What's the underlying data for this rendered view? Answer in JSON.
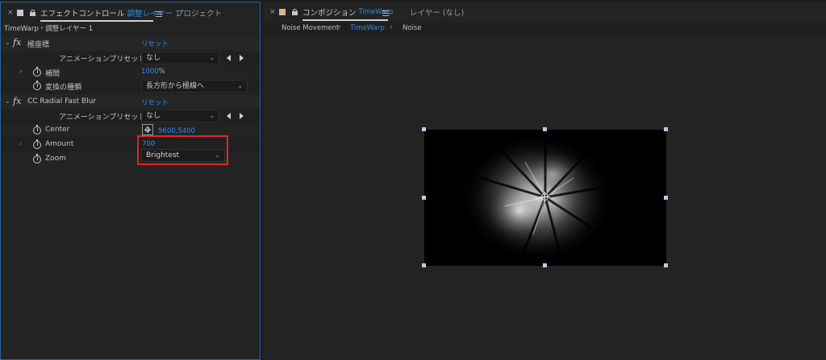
{
  "left_panel": {
    "tab": {
      "close": "×",
      "title_prefix": "エフェクトコントロール",
      "title_layer": "調整レイヤー 1",
      "inactive_tab": "プロジェクト"
    },
    "subheader": "TimeWarp・調整レイヤー 1",
    "effects": [
      {
        "name": "極座標",
        "reset": "リセット",
        "preset_label": "アニメーションプリセット :",
        "preset_value": "なし",
        "params": [
          {
            "label": "補間",
            "value": "1000",
            "unit": "%"
          },
          {
            "label": "変換の種類",
            "value": "長方形から極線へ"
          }
        ]
      },
      {
        "name": "CC Radial Fast Blur",
        "reset": "リセット",
        "preset_label": "アニメーションプリセット :",
        "preset_value": "なし",
        "params": [
          {
            "label": "Center",
            "value": "9600,5400"
          },
          {
            "label": "Amount",
            "value": "700"
          },
          {
            "label": "Zoom",
            "value": "Brightest"
          }
        ]
      }
    ],
    "highlight_color": "#e0252a",
    "accent_color": "#2d8ceb"
  },
  "right_panel": {
    "tab": {
      "close": "×",
      "title_prefix": "コンポジション",
      "title_comp": "TimeWarp",
      "layer_tab": "レイヤー (なし)"
    },
    "subtabs": [
      {
        "label": "Noise Movement",
        "active": false
      },
      {
        "label": "TimeWarp",
        "active": true
      },
      {
        "label": "Noise",
        "active": false
      }
    ]
  }
}
